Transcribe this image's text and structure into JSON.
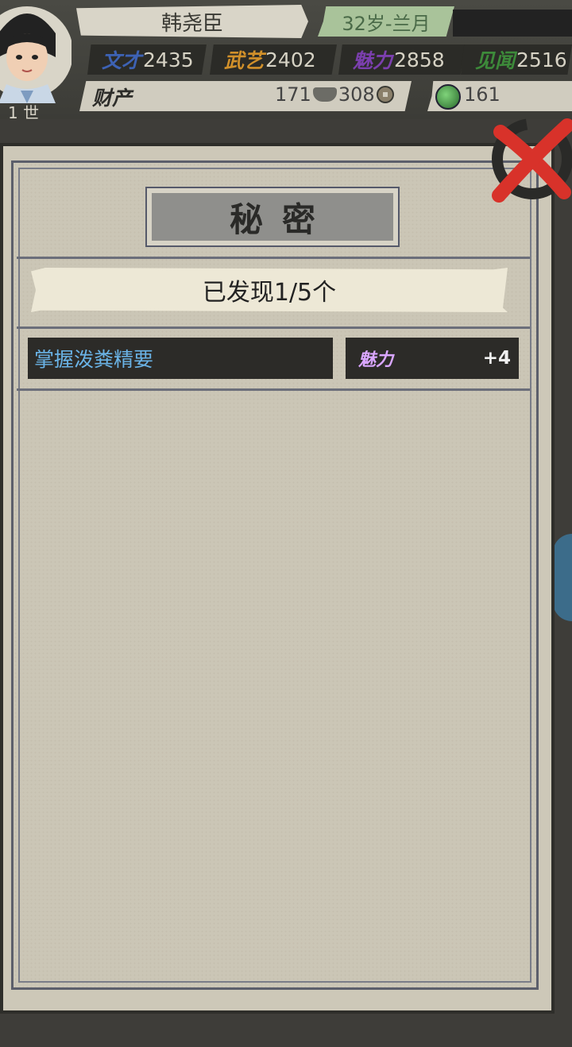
{
  "player": {
    "name": "韩尧臣",
    "age_month": "32岁-兰月",
    "avatar_label": "1 世"
  },
  "stats": [
    {
      "key": "wencai",
      "label": "文才",
      "value": "2435",
      "color": "#3d62b4"
    },
    {
      "key": "wuyi",
      "label": "武艺",
      "value": "2402",
      "color": "#d1902a"
    },
    {
      "key": "meili",
      "label": "魅力",
      "value": "2858",
      "color": "#7b3fae"
    },
    {
      "key": "jianwen",
      "label": "见闻",
      "value": "2516",
      "color": "#3d8a3a"
    }
  ],
  "wealth": {
    "label": "财产",
    "silver": "171",
    "coins": "308",
    "jade": "161"
  },
  "modal": {
    "title": "秘密",
    "found_text": "已发现1/5个",
    "secrets": [
      {
        "name": "掌握泼粪精要",
        "stat": "魅力",
        "bonus": "+4"
      }
    ]
  },
  "colors": {
    "secret_name": "#6ab3e6",
    "bonus_stat": "#d9a6ff",
    "close_red": "#d8322a"
  }
}
